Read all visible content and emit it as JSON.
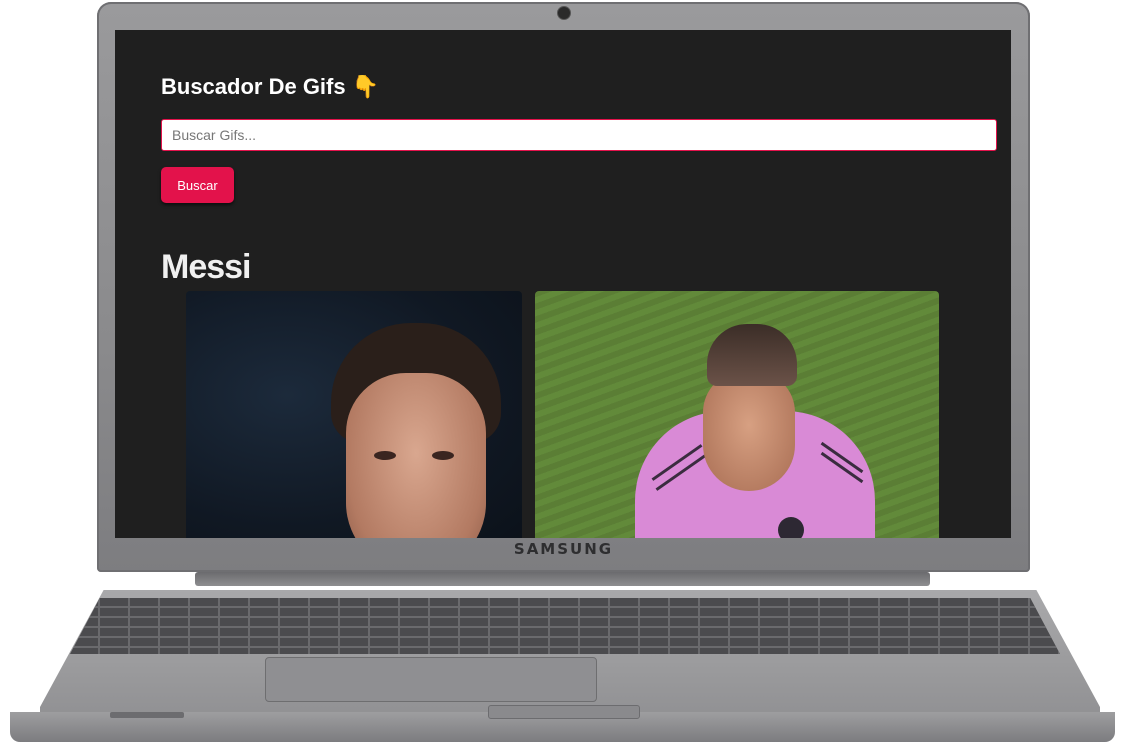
{
  "app": {
    "title": "Buscador De Gifs",
    "title_emoji": "👇"
  },
  "search": {
    "placeholder": "Buscar Gifs...",
    "value": "",
    "button_label": "Buscar"
  },
  "results": {
    "heading": "Messi",
    "gifs": [
      {
        "subject": "close-up face"
      },
      {
        "subject": "pink jersey"
      }
    ]
  },
  "device": {
    "brand": "SAMSUNG"
  },
  "colors": {
    "accent": "#e3124b",
    "background": "#1f1f1f",
    "text": "#ffffff"
  }
}
